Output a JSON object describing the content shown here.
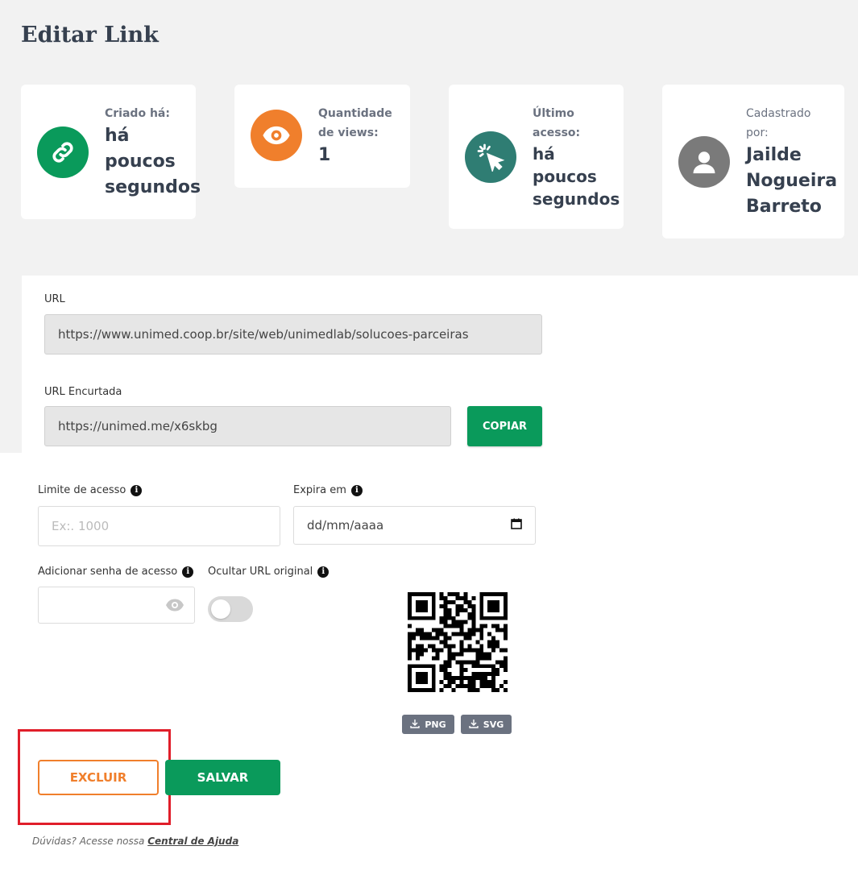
{
  "page": {
    "title": "Editar Link"
  },
  "cards": {
    "created": {
      "label": "Criado há:",
      "value": [
        "há",
        "poucos",
        "segundos"
      ],
      "icon": "link-icon",
      "color": "#0a9a5b"
    },
    "views": {
      "label": [
        "Quantidade",
        "de views:"
      ],
      "value": "1",
      "icon": "eye-icon",
      "color": "#f07f2c"
    },
    "last_access": {
      "label": [
        "Último",
        "acesso:"
      ],
      "value": [
        "há",
        "poucos",
        "segundos"
      ],
      "icon": "cursor-click-icon",
      "color": "#2f7d73"
    },
    "registered_by": {
      "label": [
        "Cadastrado",
        "por:"
      ],
      "value": [
        "Jailde",
        "Nogueira",
        "Barreto"
      ],
      "icon": "user-icon",
      "color": "#7a7a7a"
    }
  },
  "form": {
    "url": {
      "label": "URL",
      "value": "https://www.unimed.coop.br/site/web/unimedlab/solucoes-parceiras"
    },
    "short_url": {
      "label": "URL Encurtada",
      "value": "https://unimed.me/x6skbg",
      "copy_label": "COPIAR"
    },
    "access_limit": {
      "label": "Limite de acesso",
      "placeholder": "Ex:. 1000"
    },
    "expires": {
      "label": "Expira em",
      "value": "dd/mm/aaaa"
    },
    "password": {
      "label": "Adicionar senha de acesso"
    },
    "hide_url": {
      "label": "Ocultar URL original",
      "enabled": false
    },
    "qr": {
      "png_label": "PNG",
      "svg_label": "SVG"
    }
  },
  "actions": {
    "delete_label": "EXCLUIR",
    "save_label": "SALVAR"
  },
  "footer": {
    "help_text": "Dúvidas? Acesse nossa",
    "help_link": "Central de Ajuda"
  },
  "colors": {
    "primary": "#0a9a5b",
    "accent": "#f07f2c",
    "highlight": "#e01e2a"
  }
}
